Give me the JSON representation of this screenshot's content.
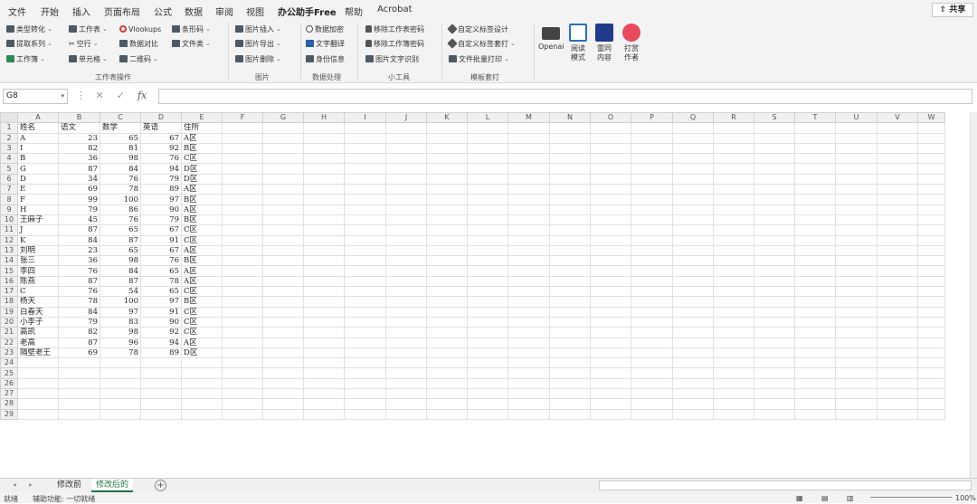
{
  "menu": [
    "文件",
    "开始",
    "插入",
    "页面布局",
    "公式",
    "数据",
    "审阅",
    "视图",
    "办公助手Free",
    "帮助",
    "Acrobat"
  ],
  "share_label": "共享",
  "ribbon": {
    "worksheet_ops": {
      "row1": [
        "类型转化",
        "工作表",
        "Vlookups",
        "条形码"
      ],
      "row2": [
        "提取系列",
        "空行",
        "数据对比",
        "文件类"
      ],
      "row3": [
        "工作簿",
        "单元格",
        "二维码"
      ],
      "label": "工作表操作"
    },
    "picture": {
      "items": [
        "图片插入",
        "图片导出",
        "图片删除"
      ],
      "label": "图片"
    },
    "data_processing": {
      "items": [
        "数据加密",
        "文字翻译",
        "身份信息"
      ],
      "label": "数据处理"
    },
    "tools": {
      "items": [
        "移除工作表密码",
        "移除工作簿密码",
        "图片文字识别"
      ],
      "label": "小工具"
    },
    "template": {
      "items": [
        "自定义标签设计",
        "自定义标签套打",
        "文件批量打印"
      ],
      "label": "模板套打"
    },
    "big_buttons": [
      "Openai",
      "阅读\n模式",
      "雷同\n内容",
      "打赏\n作者"
    ]
  },
  "namebox": "G8",
  "columns": [
    "A",
    "B",
    "C",
    "D",
    "E",
    "F",
    "G",
    "H",
    "I",
    "J",
    "K",
    "L",
    "M",
    "N",
    "O",
    "P",
    "Q",
    "R",
    "S",
    "T",
    "U",
    "V",
    "W"
  ],
  "headers": [
    "姓名",
    "语文",
    "数学",
    "英语",
    "住所"
  ],
  "rows": [
    [
      "A",
      23,
      65,
      67,
      "A区"
    ],
    [
      "I",
      82,
      81,
      92,
      "B区"
    ],
    [
      "B",
      36,
      98,
      76,
      "C区"
    ],
    [
      "G",
      87,
      84,
      94,
      "D区"
    ],
    [
      "D",
      34,
      76,
      79,
      "D区"
    ],
    [
      "E",
      69,
      78,
      89,
      "A区"
    ],
    [
      "F",
      99,
      100,
      97,
      "B区"
    ],
    [
      "H",
      79,
      86,
      90,
      "A区"
    ],
    [
      "王麻子",
      45,
      76,
      79,
      "B区"
    ],
    [
      "J",
      87,
      65,
      67,
      "C区"
    ],
    [
      "K",
      84,
      87,
      91,
      "C区"
    ],
    [
      "刘明",
      23,
      65,
      67,
      "A区"
    ],
    [
      "张三",
      36,
      98,
      76,
      "B区"
    ],
    [
      "李四",
      76,
      84,
      65,
      "A区"
    ],
    [
      "陈燕",
      87,
      87,
      78,
      "A区"
    ],
    [
      "C",
      76,
      54,
      65,
      "C区"
    ],
    [
      "杨天",
      78,
      100,
      97,
      "B区"
    ],
    [
      "白春天",
      84,
      97,
      91,
      "C区"
    ],
    [
      "小李子",
      79,
      83,
      90,
      "C区"
    ],
    [
      "高凯",
      82,
      98,
      92,
      "C区"
    ],
    [
      "老高",
      87,
      96,
      94,
      "A区"
    ],
    [
      "隔壁老王",
      69,
      78,
      89,
      "D区"
    ]
  ],
  "empty_rows": [
    24,
    25,
    26,
    27,
    28,
    29
  ],
  "sheets": [
    "修改前",
    "修改后的"
  ],
  "status": {
    "ready": "就绪",
    "accessibility": "辅助功能: 一切就绪",
    "zoom": "100%"
  },
  "accent_color": "#217346"
}
